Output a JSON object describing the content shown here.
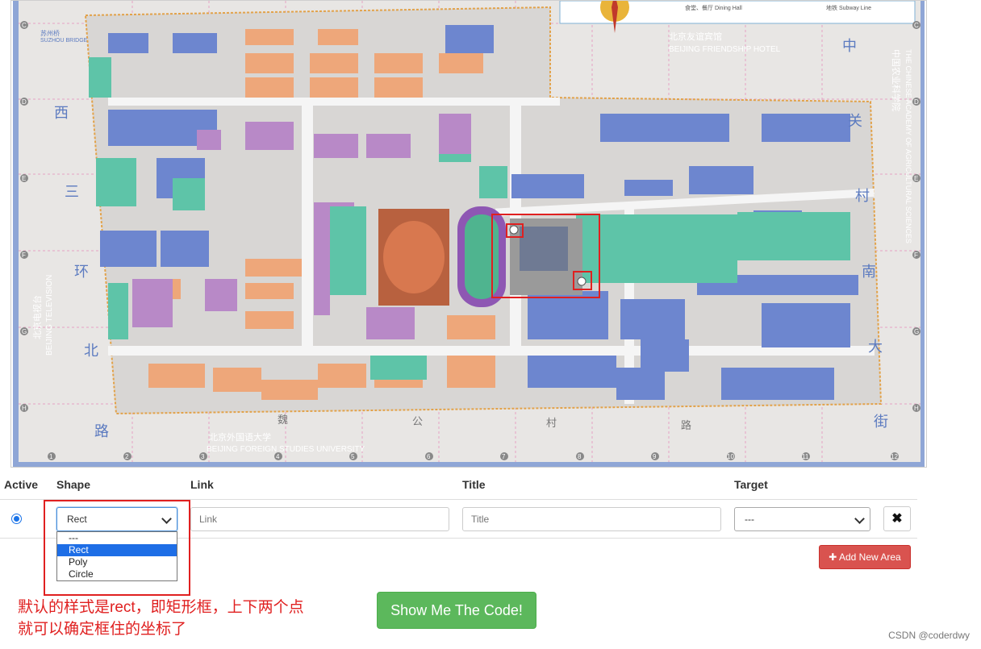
{
  "map": {
    "labels": {
      "beijing_friendship_hotel_cn": "北京友谊宾馆",
      "beijing_friendship_hotel_en": "BEIJING FRIENDSHIP HOTEL",
      "bfsu_cn": "北京外国语大学",
      "bfsu_en": "BEIJING FOREIGN STUDIES UNIVERSITY",
      "suzhou_bridge_cn": "苏州桥",
      "suzhou_bridge_en": "SUZHOU BRIDGE",
      "tv_cn": "北京电视台",
      "tv_en": "BEIJING TELEVISION",
      "academy_cn": "中国农业科学院",
      "academy_en": "THE CHINESE ACADEMY OF AGRICULTURAL SCIENCES",
      "dining_hall": "食堂、餐厅  Dining Hall",
      "subway_line": "地铁  Subway Line",
      "road_left": [
        "西",
        "三",
        "环",
        "北",
        "路"
      ],
      "road_right": [
        "中",
        "关",
        "村",
        "南",
        "大",
        "街"
      ],
      "road_bottom": [
        "魏",
        "公",
        "村",
        "路"
      ],
      "row_markers": [
        "C",
        "D",
        "E",
        "F",
        "G",
        "H"
      ],
      "col_markers": [
        "1",
        "2",
        "3",
        "4",
        "5",
        "6",
        "7",
        "8",
        "9",
        "10",
        "11",
        "12"
      ]
    }
  },
  "table": {
    "headers": {
      "active": "Active",
      "shape": "Shape",
      "link": "Link",
      "title": "Title",
      "target": "Target"
    },
    "row": {
      "shape_value": "Rect",
      "link_placeholder": "Link",
      "title_placeholder": "Title",
      "target_value": "---",
      "remove_icon": "✖"
    },
    "shape_options": [
      "---",
      "Rect",
      "Poly",
      "Circle"
    ],
    "selected_option_index": 1
  },
  "buttons": {
    "add_area_icon": "✚",
    "add_area": "Add New Area",
    "show_code": "Show Me The Code!"
  },
  "annotation": {
    "line1": "默认的样式是rect，即矩形框，上下两个点",
    "line2": "就可以确定框住的坐标了"
  },
  "watermark": "CSDN @coderdwy"
}
